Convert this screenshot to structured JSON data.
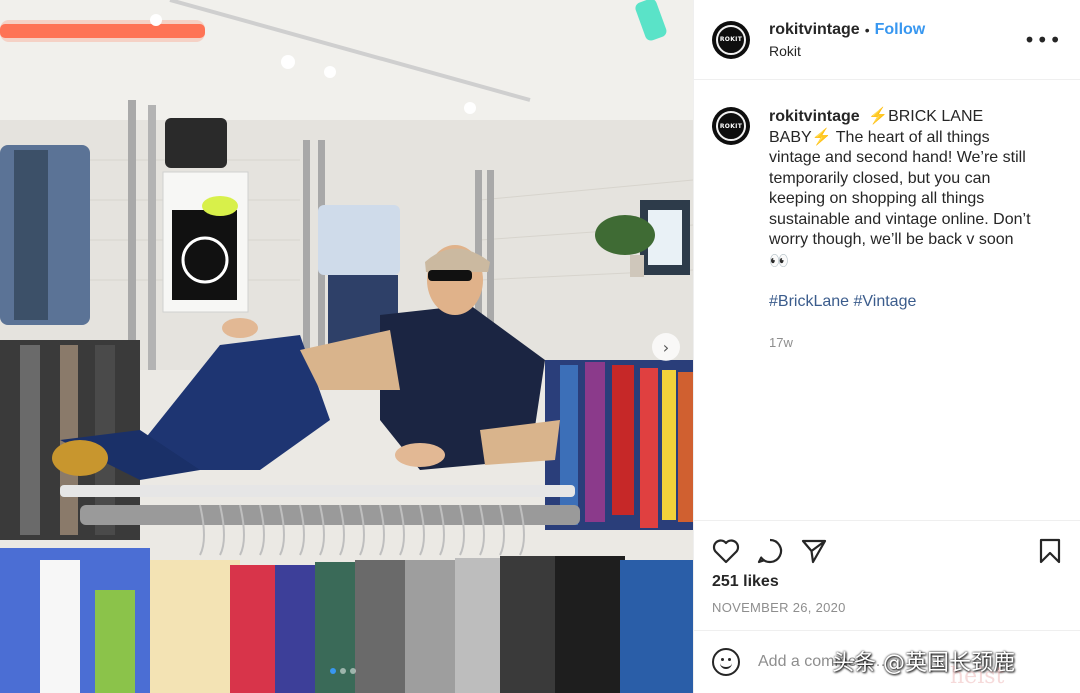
{
  "post": {
    "username": "rokitvintage",
    "dot": "•",
    "follow_label": "Follow",
    "location": "Rokit",
    "avatar_logo": "ROKIT",
    "caption": {
      "bolt_emoji": "⚡",
      "headline": "BRICK LANE BABY",
      "body": "The heart of all things vintage and second hand! We’re still temporarily closed, but you can keeping on shopping all things sustainable and vintage online. Don’t worry though, we’ll be back v soon",
      "eyes_emoji": "👀",
      "hashtags": [
        "#BrickLane",
        "#Vintage"
      ],
      "age": "17w"
    },
    "likes": "251 likes",
    "date": "NOVEMBER 26, 2020",
    "comment_placeholder": "Add a comment…",
    "icons": {
      "more": "more-options-icon",
      "like": "heart-icon",
      "comment": "comment-icon",
      "share": "share-icon",
      "save": "bookmark-icon",
      "emoji": "emoji-icon",
      "next": "chevron-right-icon"
    }
  },
  "photo": {
    "carousel_count": 3,
    "carousel_active": 0
  },
  "watermark": "头条 @英国长颈鹿",
  "watermark_sub": "heist",
  "colors": {
    "link": "#3897f0",
    "hashtag": "#3b5c8c",
    "muted": "#8e8e8e"
  }
}
